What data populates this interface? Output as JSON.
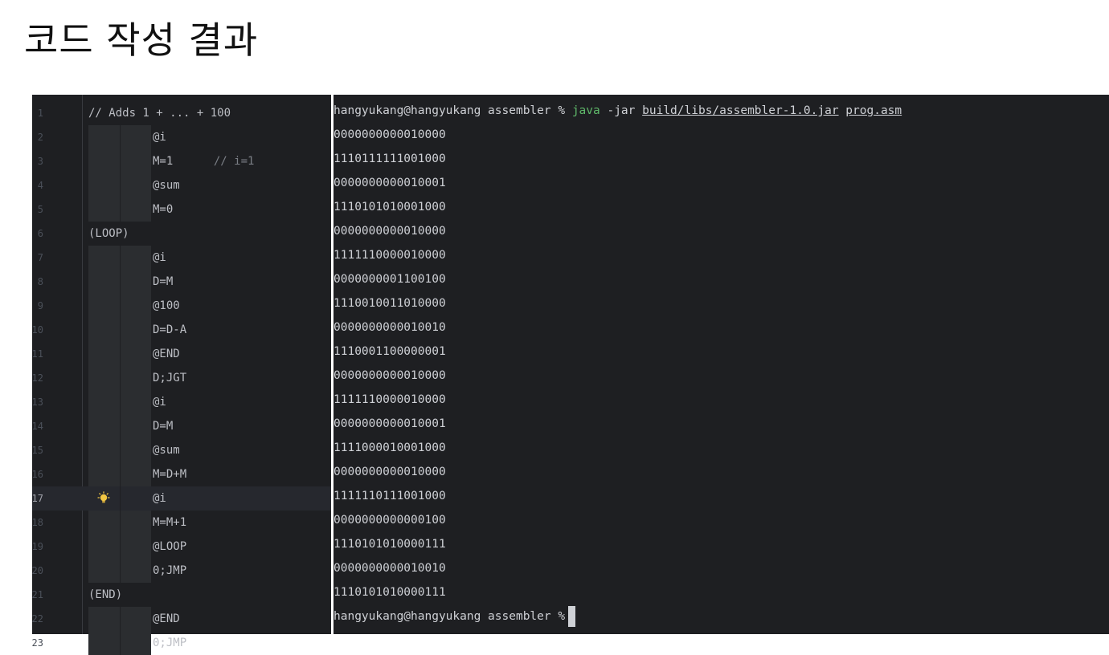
{
  "slide": {
    "title": "코드 작성 결과"
  },
  "editor": {
    "lines": [
      {
        "num": "1",
        "indent": 0,
        "code": "// Adds 1 + ... + 100",
        "comment": ""
      },
      {
        "num": "2",
        "indent": 2,
        "code": "@i",
        "comment": ""
      },
      {
        "num": "3",
        "indent": 2,
        "code": "M=1",
        "comment": "// i=1"
      },
      {
        "num": "4",
        "indent": 2,
        "code": "@sum",
        "comment": ""
      },
      {
        "num": "5",
        "indent": 2,
        "code": "M=0",
        "comment": ""
      },
      {
        "num": "6",
        "indent": 0,
        "code": "(LOOP)",
        "comment": ""
      },
      {
        "num": "7",
        "indent": 2,
        "code": "@i",
        "comment": ""
      },
      {
        "num": "8",
        "indent": 2,
        "code": "D=M",
        "comment": ""
      },
      {
        "num": "9",
        "indent": 2,
        "code": "@100",
        "comment": ""
      },
      {
        "num": "10",
        "indent": 2,
        "code": "D=D-A",
        "comment": ""
      },
      {
        "num": "11",
        "indent": 2,
        "code": "@END",
        "comment": ""
      },
      {
        "num": "12",
        "indent": 2,
        "code": "D;JGT",
        "comment": ""
      },
      {
        "num": "13",
        "indent": 2,
        "code": "@i",
        "comment": ""
      },
      {
        "num": "14",
        "indent": 2,
        "code": "D=M",
        "comment": ""
      },
      {
        "num": "15",
        "indent": 2,
        "code": "@sum",
        "comment": ""
      },
      {
        "num": "16",
        "indent": 2,
        "code": "M=D+M",
        "comment": ""
      },
      {
        "num": "17",
        "indent": 2,
        "code": "@i",
        "comment": "",
        "active": true,
        "bulb": true
      },
      {
        "num": "18",
        "indent": 2,
        "code": "M=M+1",
        "comment": ""
      },
      {
        "num": "19",
        "indent": 2,
        "code": "@LOOP",
        "comment": ""
      },
      {
        "num": "20",
        "indent": 2,
        "code": "0;JMP",
        "comment": ""
      },
      {
        "num": "21",
        "indent": 0,
        "code": "(END)",
        "comment": ""
      },
      {
        "num": "22",
        "indent": 2,
        "code": "@END",
        "comment": ""
      },
      {
        "num": "23",
        "indent": 2,
        "code": "0;JMP",
        "comment": ""
      }
    ]
  },
  "terminal": {
    "prompt": "hangyukang@hangyukang assembler % ",
    "command": {
      "program": "java",
      "flag": " -jar ",
      "jar_path": "build/libs/assembler-1.0.jar",
      "space": " ",
      "arg": "prog.asm"
    },
    "output": [
      "0000000000010000",
      "1110111111001000",
      "0000000000010001",
      "1110101010001000",
      "0000000000010000",
      "1111110000010000",
      "0000000001100100",
      "1110010011010000",
      "0000000000010010",
      "1110001100000001",
      "0000000000010000",
      "1111110000010000",
      "0000000000010001",
      "1111000010001000",
      "0000000000010000",
      "1111110111001000",
      "0000000000000100",
      "1110101010000111",
      "0000000000010010",
      "1110101010000111"
    ],
    "final_prompt": "hangyukang@hangyukang assembler %"
  },
  "colors": {
    "background": "#1e1f22",
    "command_green": "#5fb86a",
    "comment_gray": "#7a7e85"
  },
  "icons": {
    "bulb": "lightbulb-icon"
  }
}
